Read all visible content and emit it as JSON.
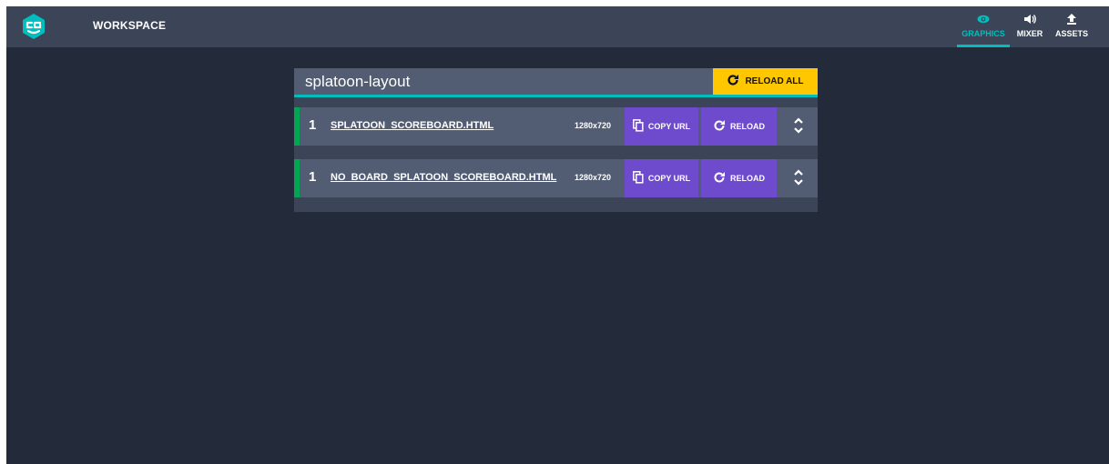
{
  "topbar": {
    "title": "WORKSPACE",
    "tabs": [
      {
        "label": "GRAPHICS",
        "icon": "eye-icon",
        "active": true
      },
      {
        "label": "MIXER",
        "icon": "speaker-icon",
        "active": false
      },
      {
        "label": "ASSETS",
        "icon": "upload-icon",
        "active": false
      }
    ]
  },
  "panel": {
    "title": "splatoon-layout",
    "reload_all_label": "RELOAD ALL",
    "rows": [
      {
        "count": "1",
        "name": "SPLATOON_SCOREBOARD.HTML",
        "resolution": "1280x720",
        "copy_label": "COPY URL",
        "reload_label": "RELOAD"
      },
      {
        "count": "1",
        "name": "NO_BOARD_SPLATOON_SCOREBOARD.HTML",
        "resolution": "1280x720",
        "copy_label": "COPY URL",
        "reload_label": "RELOAD"
      }
    ]
  },
  "colors": {
    "accent": "#00bebe",
    "reload_all": "#ffc700",
    "button": "#6e4bcc",
    "marker": "#00a651"
  }
}
